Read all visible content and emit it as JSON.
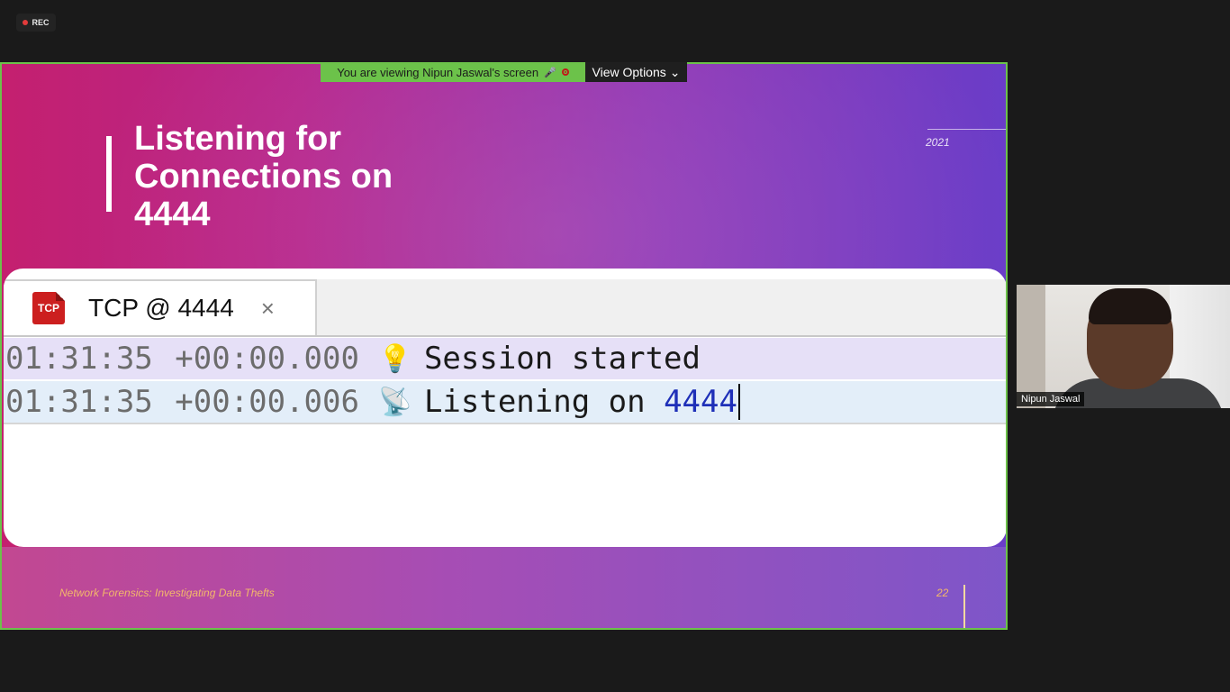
{
  "recording": {
    "label": "REC"
  },
  "share_banner": {
    "viewing_text": "You are viewing Nipun Jaswal's screen",
    "view_options_label": "View Options",
    "view_options_icon": "chevron-down-icon",
    "banner_color": "#6cc24a"
  },
  "slide": {
    "title": "Listening for Connections on 4444",
    "year": "2021",
    "footer_text": "Network Forensics: Investigating Data Thefts",
    "page_number": "22",
    "gradient_colors": [
      "#c4206f",
      "#6a3dc8"
    ]
  },
  "terminal": {
    "tab_title": "TCP @ 4444",
    "tab_logo_text": "TCP",
    "close_symbol": "×",
    "rows": [
      {
        "time": "01:31:35",
        "offset": "+00:00.000",
        "icon": "lightbulb-icon",
        "icon_glyph": "💡",
        "message": "Session started",
        "port": ""
      },
      {
        "time": "01:31:35",
        "offset": "+00:00.006",
        "icon": "satellite-dish-icon",
        "icon_glyph": "📡",
        "message": "Listening on ",
        "port": "4444"
      }
    ]
  },
  "participant": {
    "name": "Nipun Jaswal"
  }
}
